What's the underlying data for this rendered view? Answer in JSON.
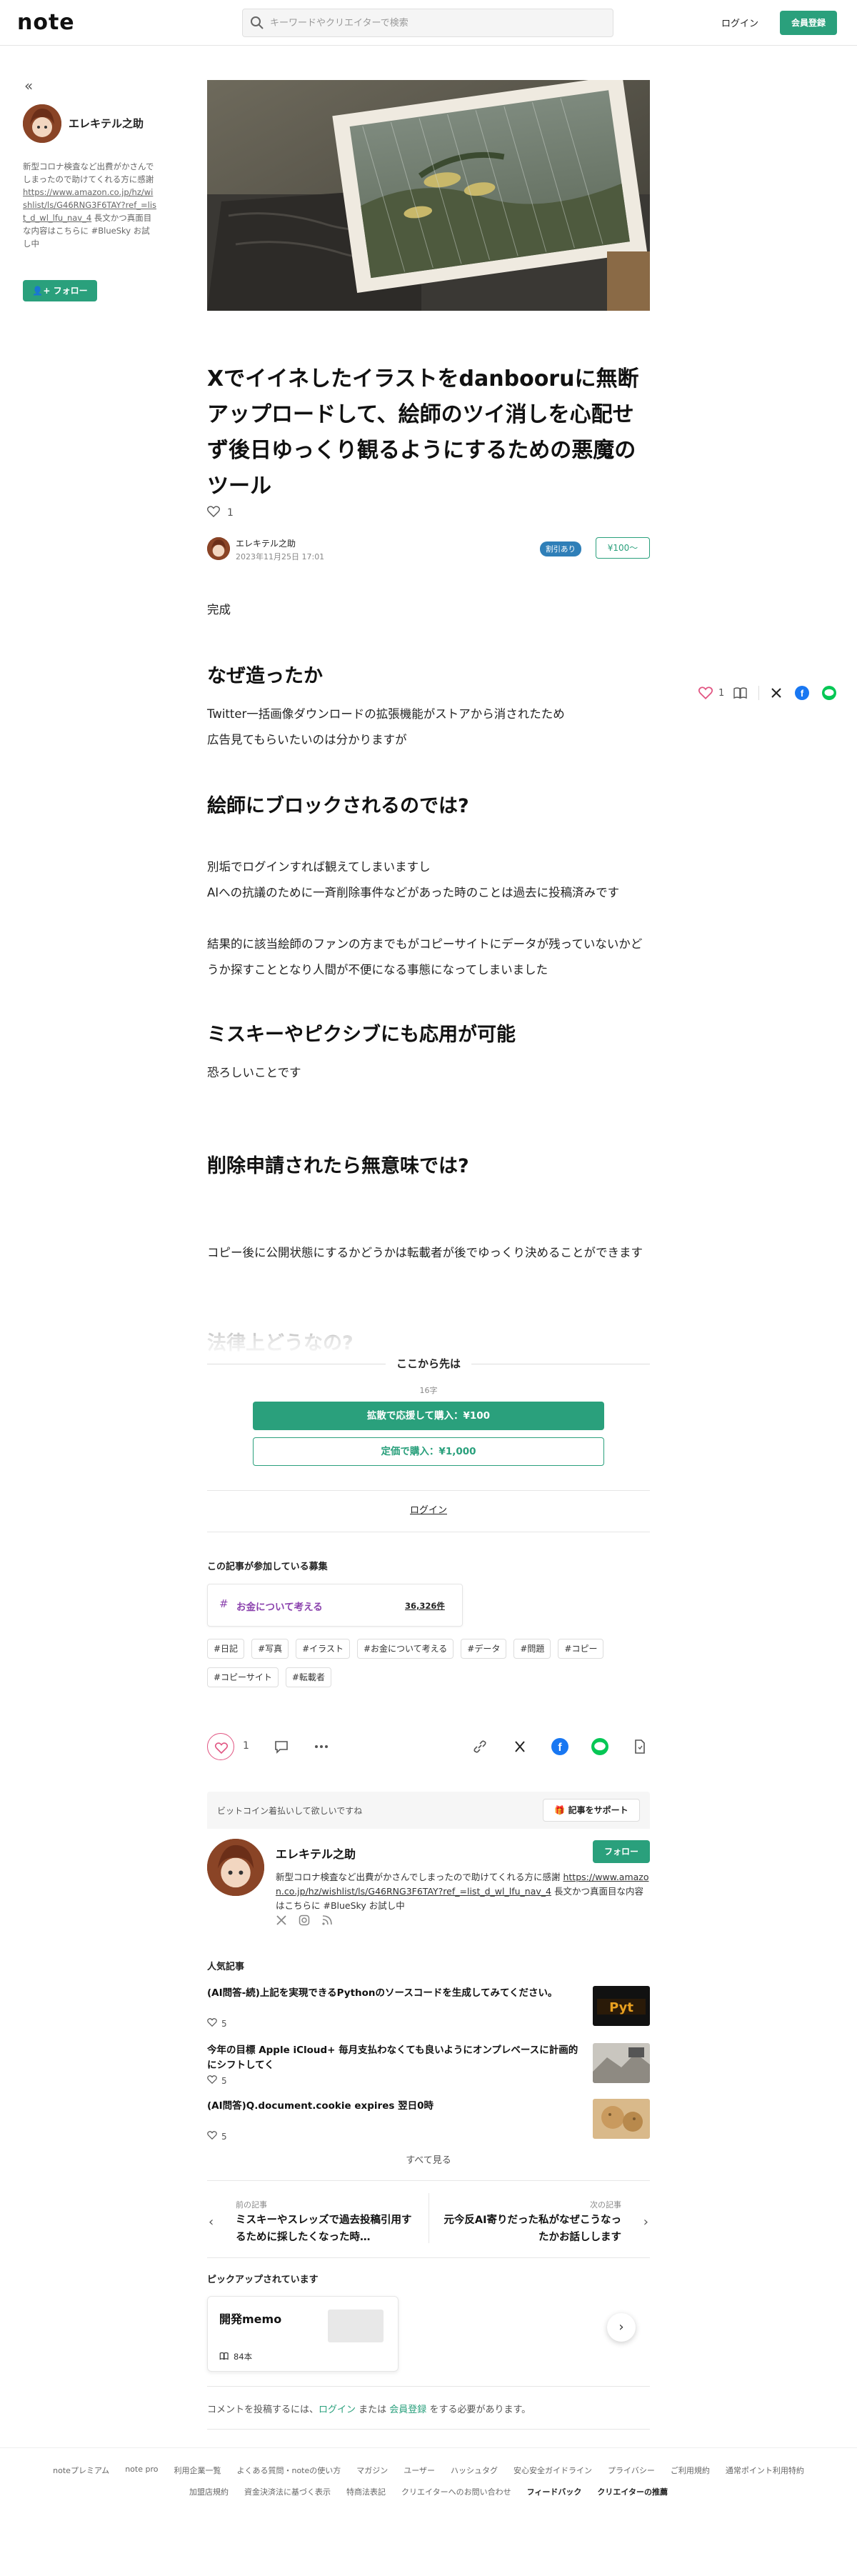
{
  "header": {
    "logo": "note",
    "search_placeholder": "キーワードやクリエイターで検索",
    "login": "ログイン",
    "signup": "会員登録"
  },
  "sidebar": {
    "name": "エレキテル之助",
    "bio_before": "新型コロナ検査など出費がかさんでしまったので助けてくれる方に感謝 ",
    "bio_link": "https://www.amazon.co.jp/hz/wishlist/ls/G46RNG3F6TAY?ref_=list_d_wl_lfu_nav_4",
    "bio_after": " 長文かつ真面目な内容はこちらに #BlueSky お試し中",
    "follow": "フォロー"
  },
  "article": {
    "title": "Xでイイネしたイラストをdanbooruに無断アップロードして、絵師のツイ消しを心配せず後日ゆっくり観るようにするための悪魔のツール",
    "like_count": "1",
    "author": "エレキテル之助",
    "date": "2023年11月25日 17:01",
    "discount_badge": "割引あり",
    "price": "¥100〜",
    "p_complete": "完成",
    "h_why": "なぜ造ったか",
    "p_why": [
      "Twitter一括画像ダウンロードの拡張機能がストアから消されたため",
      "広告見てもらいたいのは分かりますが"
    ],
    "h_block": "絵師にブロックされるのでは?",
    "p_block": [
      "別垢でログインすれば観えてしまいますし",
      "AIへの抗議のために一斉削除事件などがあった時のことは過去に投稿済みです",
      "結果的に該当絵師のファンの方までもがコピーサイトにデータが残っていないかどうか探すこととなり人間が不便になる事態になってしまいました"
    ],
    "h_misskey": "ミスキーやピクシブにも応用が可能",
    "p_misskey": "恐ろしいことです",
    "h_delete": "削除申請されたら無意味では?",
    "p_delete": "コピー後に公開状態にするかどうかは転載者が後でゆっくり決めることができます",
    "h_faded": "法律上どうなの?"
  },
  "float_share": {
    "like_count": "1"
  },
  "paywall": {
    "title": "ここから先は",
    "chars": "16字",
    "buy_support": "拡散で応援して購入：¥100",
    "buy_regular": "定価で購入：¥1,000",
    "login": "ログイン"
  },
  "contest": {
    "label": "この記事が参加している募集",
    "name": "お金について考える",
    "count": "36,326件"
  },
  "tags": [
    "#日記",
    "#写真",
    "#イラスト",
    "#お金について考える",
    "#データ",
    "#問題",
    "#コピー",
    "#コピーサイト",
    "#転載者"
  ],
  "actions": {
    "like_count": "1"
  },
  "support": {
    "text": "ビットコイン着払いして欲しいですね",
    "button": "記事をサポート"
  },
  "creator": {
    "name": "エレキテル之助",
    "follow": "フォロー",
    "bio_before": "新型コロナ検査など出費がかさんでしまったので助けてくれる方に感謝 ",
    "bio_link": "https://www.amazon.co.jp/hz/wishlist/ls/G46RNG3F6TAY?ref_=list_d_wl_lfu_nav_4",
    "bio_after": " 長文かつ真面目な内容はこちらに #BlueSky お試し中"
  },
  "popular": {
    "label": "人気記事",
    "items": [
      {
        "title": "(AI問答-続)上記を実現できるPythonのソースコードを生成してみてください。",
        "likes": "5"
      },
      {
        "title": "今年の目標 Apple iCloud+ 毎月支払わなくても良いようにオンプレベースに計画的にシフトしてく",
        "likes": "5"
      },
      {
        "title": "(AI問答)Q.document.cookie expires 翌日0時",
        "likes": "5"
      }
    ],
    "see_all": "すべて見る"
  },
  "prev_next": {
    "prev_label": "前の記事",
    "prev_title": "ミスキーやスレッズで過去投稿引用するために採したくなった時…",
    "next_label": "次の記事",
    "next_title": "元今反AI寄りだった私がなぜこうなったかお話しします"
  },
  "pickup": {
    "label": "ピックアップされています",
    "card_title": "開発memo",
    "card_count": "84本"
  },
  "comment": {
    "before": "コメントを投稿するには、",
    "login": "ログイン",
    "middle": " または ",
    "signup": "会員登録",
    "after": " をする必要があります。"
  },
  "footer": {
    "row1": [
      "noteプレミアム",
      "note pro",
      "利用企業一覧",
      "よくある質問・noteの使い方",
      "マガジン",
      "ユーザー",
      "ハッシュタグ",
      "安心安全ガイドライン",
      "プライバシー",
      "ご利用規約",
      "通常ポイント利用特約"
    ],
    "row2": [
      "加盟店規約",
      "資金決済法に基づく表示",
      "特商法表記",
      "クリエイターへのお問い合わせ",
      "フィードバック",
      "クリエイターの推薦"
    ]
  },
  "colors": {
    "accent": "#2aa07c",
    "like": "#e15582",
    "contest": "#8c44ae",
    "discount": "#2f7fb8"
  }
}
